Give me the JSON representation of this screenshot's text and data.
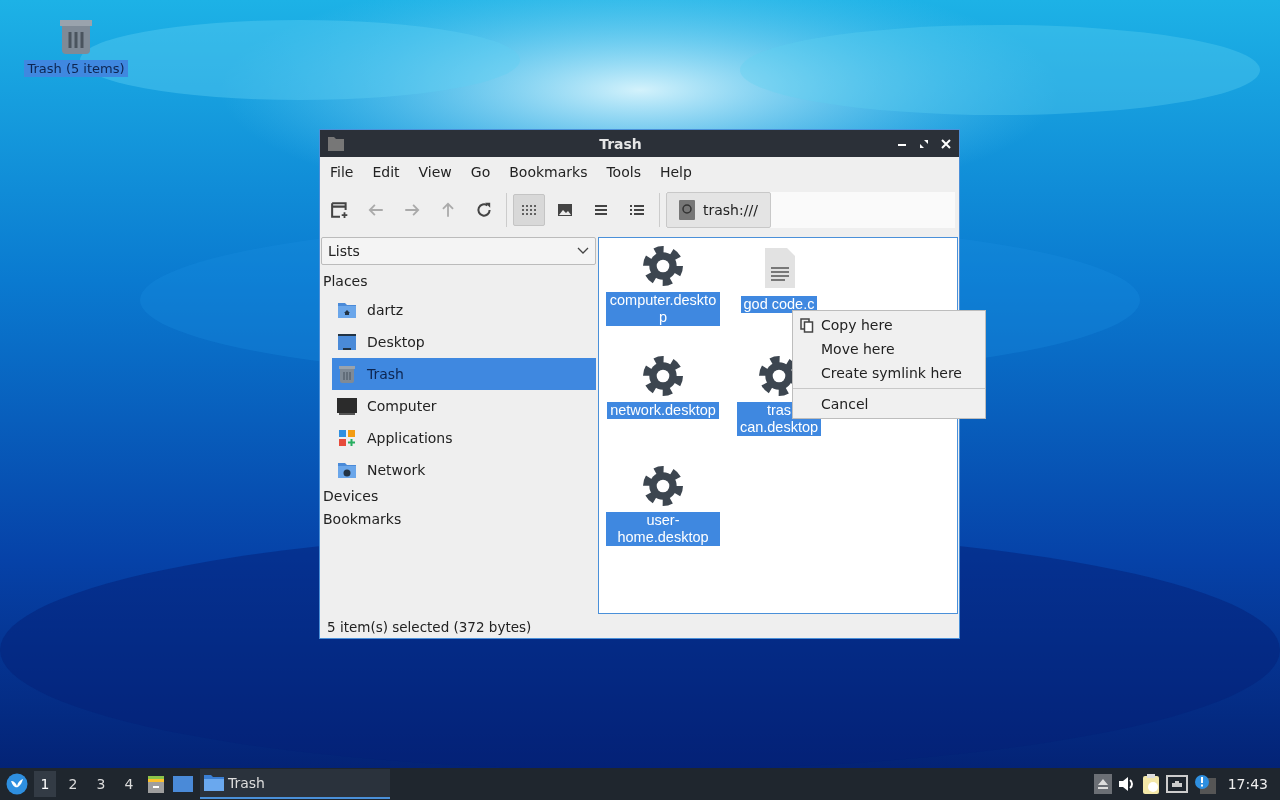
{
  "desktop_icons": [
    {
      "label": "Trash (5 items)",
      "selected": true
    }
  ],
  "window": {
    "title": "Trash",
    "menu": [
      "File",
      "Edit",
      "View",
      "Go",
      "Bookmarks",
      "Tools",
      "Help"
    ],
    "view_modes": [
      {
        "selected": true
      },
      {
        "selected": false
      },
      {
        "selected": false
      },
      {
        "selected": false
      }
    ],
    "location": "trash:///",
    "sidebar": {
      "dropdown": "Lists",
      "sections": [
        {
          "title": "Places",
          "items": [
            {
              "label": "dartz",
              "selected": false
            },
            {
              "label": "Desktop",
              "selected": false
            },
            {
              "label": "Trash",
              "selected": true
            },
            {
              "label": "Computer",
              "selected": false
            },
            {
              "label": "Applications",
              "selected": false
            },
            {
              "label": "Network",
              "selected": false
            }
          ]
        },
        {
          "title": "Devices"
        },
        {
          "title": "Bookmarks"
        }
      ]
    },
    "files": [
      {
        "name": "computer.desktop",
        "kind": "settings",
        "selected": true
      },
      {
        "name": "god code.c",
        "kind": "text",
        "selected": true
      },
      {
        "name": "network.desktop",
        "kind": "settings",
        "selected": true
      },
      {
        "name": "tras\ncan.desktop",
        "kind": "settings",
        "selected": true
      },
      {
        "name": "user-home.desktop",
        "kind": "settings",
        "selected": true
      }
    ],
    "status": "5 item(s) selected (372 bytes)"
  },
  "context_menu": [
    {
      "label": "Copy here",
      "kind": "copy"
    },
    {
      "label": "Move here",
      "kind": "plain"
    },
    {
      "label": "Create symlink here",
      "kind": "plain"
    },
    {
      "kind": "separator"
    },
    {
      "label": "Cancel",
      "kind": "plain"
    }
  ],
  "taskbar": {
    "workspaces": [
      {
        "label": "1",
        "selected": true
      },
      {
        "label": "2",
        "selected": false
      },
      {
        "label": "3",
        "selected": false
      },
      {
        "label": "4",
        "selected": false
      }
    ],
    "tasks": [
      {
        "label": "Trash",
        "selected": true
      }
    ],
    "clock": "17:43"
  }
}
